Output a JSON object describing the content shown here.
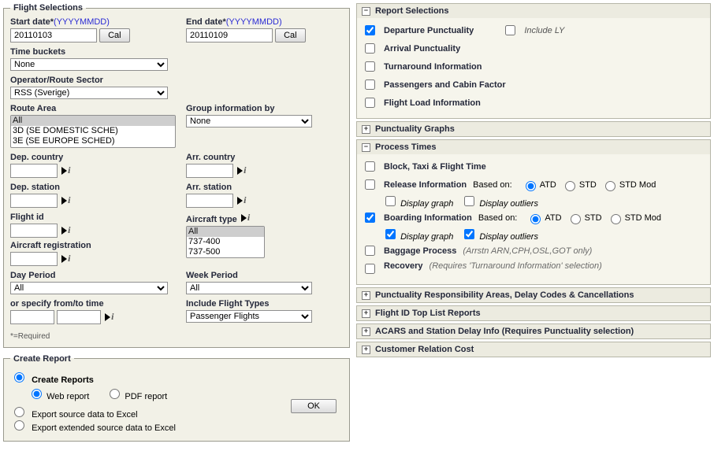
{
  "flightSelections": {
    "legend": "Flight Selections",
    "startDateLabel": "Start date*",
    "dateHint": "(YYYYMMDD)",
    "startDateValue": "20110103",
    "endDateLabel": "End date*",
    "endDateValue": "20110109",
    "calBtn": "Cal",
    "timeBucketsLabel": "Time buckets",
    "timeBucketsValue": "None",
    "operatorLabel": "Operator/Route Sector",
    "operatorValue": "RSS (Sverige)",
    "routeAreaLabel": "Route Area",
    "routeAreaOptions": [
      "All",
      "3D (SE DOMESTIC SCHE)",
      "3E (SE EUROPE SCHED)"
    ],
    "groupByLabel": "Group information by",
    "groupByValue": "None",
    "depCountryLabel": "Dep. country",
    "arrCountryLabel": "Arr. country",
    "depStationLabel": "Dep. station",
    "arrStationLabel": "Arr. station",
    "flightIdLabel": "Flight id",
    "aircraftTypeLabel": "Aircraft type",
    "aircraftTypeOptions": [
      "All",
      "737-400",
      "737-500"
    ],
    "aircraftRegLabel": "Aircraft registration",
    "dayPeriodLabel": "Day Period",
    "dayPeriodValue": "All",
    "weekPeriodLabel": "Week Period",
    "weekPeriodValue": "All",
    "specifyTimeLabel": "or specify from/to time",
    "includeFTLabel": "Include Flight Types",
    "includeFTValue": "Passenger Flights",
    "footnote": "*=Required"
  },
  "createReport": {
    "legend": "Create Report",
    "createReports": "Create Reports",
    "webReport": "Web report",
    "pdfReport": "PDF report",
    "exportExcel": "Export source data to Excel",
    "exportExtended": "Export extended source data to Excel",
    "okBtn": "OK"
  },
  "reportSelections": {
    "title": "Report Selections",
    "items": [
      {
        "label": "Departure Punctuality",
        "checked": true
      },
      {
        "label": "Arrival Punctuality",
        "checked": false
      },
      {
        "label": "Turnaround Information",
        "checked": false
      },
      {
        "label": "Passengers and Cabin Factor",
        "checked": false
      },
      {
        "label": "Flight Load Information",
        "checked": false
      }
    ],
    "includeLY": "Include LY"
  },
  "punctualityGraphs": {
    "title": "Punctuality Graphs"
  },
  "processTimes": {
    "title": "Process Times",
    "blockTaxi": "Block, Taxi & Flight Time",
    "release": "Release Information",
    "boarding": "Boarding Information",
    "baggage": "Baggage Process",
    "baggageNote": "(Arrstn ARN,CPH,OSL,GOT only)",
    "recovery": "Recovery",
    "recoveryNote": "(Requires 'Turnaround Information' selection)",
    "basedOn": "Based on:",
    "radioATD": "ATD",
    "radioSTD": "STD",
    "radioSTDMod": "STD Mod",
    "displayGraph": "Display graph",
    "displayOutliers": "Display outliers"
  },
  "respAreas": {
    "title": "Punctuality Responsibility Areas, Delay Codes & Cancellations"
  },
  "flightIdTop": {
    "title": "Flight ID Top List Reports"
  },
  "acars": {
    "title": "ACARS and Station Delay Info (Requires Punctuality selection)"
  },
  "crc": {
    "title": "Customer Relation Cost"
  }
}
